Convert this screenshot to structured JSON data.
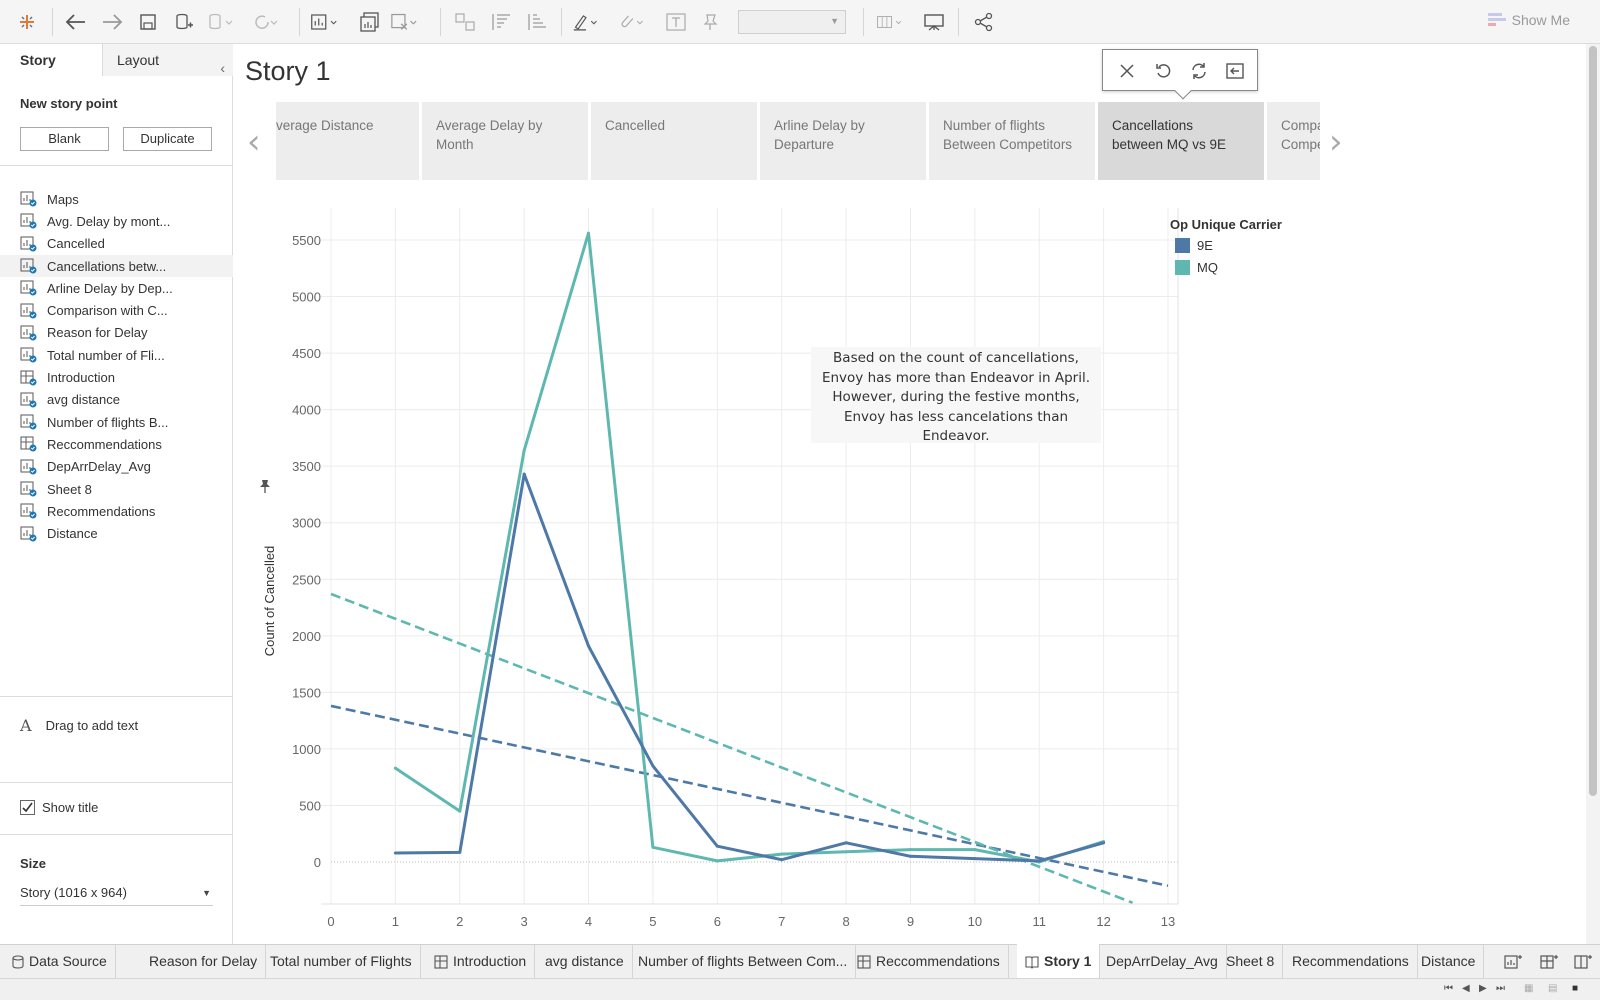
{
  "toolbar": {
    "show_me_label": "Show Me"
  },
  "left_panel": {
    "tab_story": "Story",
    "tab_layout": "Layout",
    "new_story_point": "New story point",
    "blank_button": "Blank",
    "duplicate_button": "Duplicate",
    "sheets": [
      {
        "label": "Maps",
        "kind": "chart"
      },
      {
        "label": "Avg. Delay by mont...",
        "kind": "chart"
      },
      {
        "label": "Cancelled",
        "kind": "chart"
      },
      {
        "label": "Cancellations betw...",
        "kind": "chart"
      },
      {
        "label": "Arline Delay by Dep...",
        "kind": "chart"
      },
      {
        "label": "Comparison with C...",
        "kind": "chart"
      },
      {
        "label": "Reason for Delay",
        "kind": "chart"
      },
      {
        "label": "Total number of Fli...",
        "kind": "chart"
      },
      {
        "label": "Introduction",
        "kind": "dashboard"
      },
      {
        "label": "avg distance",
        "kind": "chart"
      },
      {
        "label": "Number of flights B...",
        "kind": "chart"
      },
      {
        "label": "Reccommendations",
        "kind": "dashboard"
      },
      {
        "label": "DepArrDelay_Avg",
        "kind": "chart"
      },
      {
        "label": "Sheet 8",
        "kind": "chart"
      },
      {
        "label": "Recommendations",
        "kind": "chart"
      },
      {
        "label": "Distance",
        "kind": "chart"
      }
    ],
    "drag_text": "Drag to add text",
    "show_title": "Show title",
    "size_label": "Size",
    "size_value": "Story (1016 x 964)"
  },
  "story": {
    "title": "Story 1",
    "points": [
      {
        "label": "verage Distance",
        "active": false
      },
      {
        "label": "Average Delay by\nMonth",
        "active": false
      },
      {
        "label": "Cancelled",
        "active": false
      },
      {
        "label": "Arline Delay by\nDeparture",
        "active": false
      },
      {
        "label": "Number of flights\nBetween Competitors",
        "active": false
      },
      {
        "label": "Cancellations\nbetween MQ vs 9E",
        "active": true
      },
      {
        "label": "Compa\nCompe",
        "active": false
      }
    ]
  },
  "chart_data": {
    "type": "line",
    "xlabel": "",
    "ylabel": "Count of Cancelled",
    "xlim": [
      0,
      13
    ],
    "ylim": [
      -350,
      5650
    ],
    "x_ticks": [
      0,
      1,
      2,
      3,
      4,
      5,
      6,
      7,
      8,
      9,
      10,
      11,
      12,
      13
    ],
    "y_ticks": [
      0,
      500,
      1000,
      1500,
      2000,
      2500,
      3000,
      3500,
      4000,
      4500,
      5000,
      5500
    ],
    "legend_title": "Op Unique Carrier",
    "legend_position": "top-right",
    "x": [
      1,
      2,
      3,
      4,
      5,
      6,
      7,
      8,
      9,
      10,
      11,
      12
    ],
    "series": [
      {
        "name": "9E",
        "color": "#4e79a7",
        "values": [
          80,
          85,
          3430,
          1910,
          850,
          140,
          20,
          170,
          50,
          30,
          10,
          170
        ],
        "trend": {
          "x": [
            0,
            13
          ],
          "y": [
            1380,
            -210
          ]
        }
      },
      {
        "name": "MQ",
        "color": "#5fb8b0",
        "values": [
          830,
          450,
          3640,
          5560,
          130,
          10,
          70,
          90,
          110,
          110,
          0,
          180
        ],
        "trend": {
          "x": [
            0,
            12.45
          ],
          "y": [
            2370,
            -360
          ]
        }
      }
    ],
    "annotation": "Based on the count of cancellations,\nEnvoy has more than Endeavor in April.\nHowever, during the festive months,\nEnvoy has less cancelations than\nEndeavor."
  },
  "bottom_tabs": [
    {
      "label": "Data Source",
      "icon": "database-icon"
    },
    {
      "label": "Reason for Delay",
      "icon": ""
    },
    {
      "label": "Total number of Flights",
      "icon": ""
    },
    {
      "label": "Introduction",
      "icon": "dashboard-icon"
    },
    {
      "label": "avg distance",
      "icon": ""
    },
    {
      "label": "Number of flights Between Com...",
      "icon": ""
    },
    {
      "label": "Reccommendations",
      "icon": "dashboard-icon"
    },
    {
      "label": "Story 1",
      "icon": "story-icon",
      "active": true
    },
    {
      "label": "DepArrDelay_Avg",
      "icon": ""
    },
    {
      "label": "Sheet 8",
      "icon": ""
    },
    {
      "label": "Recommendations",
      "icon": ""
    },
    {
      "label": "Distance",
      "icon": ""
    }
  ]
}
